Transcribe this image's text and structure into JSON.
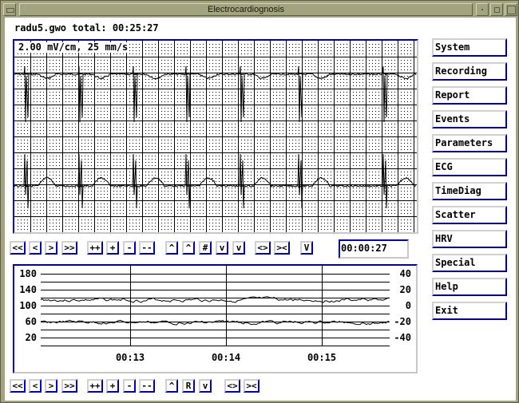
{
  "window": {
    "title": "Electrocardiognosis",
    "controls": [
      "window-menu",
      "minimize",
      "maximize",
      "close"
    ]
  },
  "header": {
    "file_info": "radu5.gwo total: 00:25:27"
  },
  "ecg": {
    "scale_label": "2.00 mV/cm, 25 mm/s",
    "channels": 2,
    "grid": "dotted minor grid with solid major lines",
    "beat_positions_fraction": [
      0.02,
      0.155,
      0.29,
      0.42,
      0.555,
      0.7,
      0.91
    ]
  },
  "ecg_toolbar": {
    "buttons": [
      {
        "id": "first",
        "label": "<<"
      },
      {
        "id": "prev",
        "label": "<"
      },
      {
        "id": "next",
        "label": ">"
      },
      {
        "id": "last",
        "label": ">>"
      },
      {
        "id": "zoom-in-more",
        "label": "++"
      },
      {
        "id": "zoom-in",
        "label": "+"
      },
      {
        "id": "zoom-out",
        "label": "-"
      },
      {
        "id": "zoom-out-more",
        "label": "--"
      },
      {
        "id": "up-1",
        "label": "^"
      },
      {
        "id": "up-2",
        "label": "^"
      },
      {
        "id": "hash",
        "label": "#"
      },
      {
        "id": "down-1",
        "label": "v"
      },
      {
        "id": "down-2",
        "label": "v"
      },
      {
        "id": "expand",
        "label": "<>"
      },
      {
        "id": "compress",
        "label": "><"
      },
      {
        "id": "v-mode",
        "label": "V"
      }
    ],
    "time_value": "00:00:27"
  },
  "trend": {
    "left_axis": [
      "180",
      "140",
      "100",
      "60",
      "20"
    ],
    "right_axis": [
      "40",
      "20",
      "0",
      "-20",
      "-40"
    ],
    "time_labels": [
      "00:13",
      "00:14",
      "00:15"
    ]
  },
  "trend_toolbar": {
    "buttons": [
      {
        "id": "first",
        "label": "<<"
      },
      {
        "id": "prev",
        "label": "<"
      },
      {
        "id": "next",
        "label": ">"
      },
      {
        "id": "last",
        "label": ">>"
      },
      {
        "id": "zoom-in-more",
        "label": "++"
      },
      {
        "id": "zoom-in",
        "label": "+"
      },
      {
        "id": "zoom-out",
        "label": "-"
      },
      {
        "id": "zoom-out-more",
        "label": "--"
      },
      {
        "id": "up",
        "label": "^"
      },
      {
        "id": "reset",
        "label": "R"
      },
      {
        "id": "down",
        "label": "v"
      },
      {
        "id": "expand",
        "label": "<>"
      },
      {
        "id": "compress",
        "label": "><"
      }
    ]
  },
  "menu": {
    "items": [
      "System",
      "Recording",
      "Report",
      "Events",
      "Parameters",
      "ECG",
      "TimeDiag",
      "Scatter",
      "HRV",
      "Special",
      "Help",
      "Exit"
    ]
  }
}
